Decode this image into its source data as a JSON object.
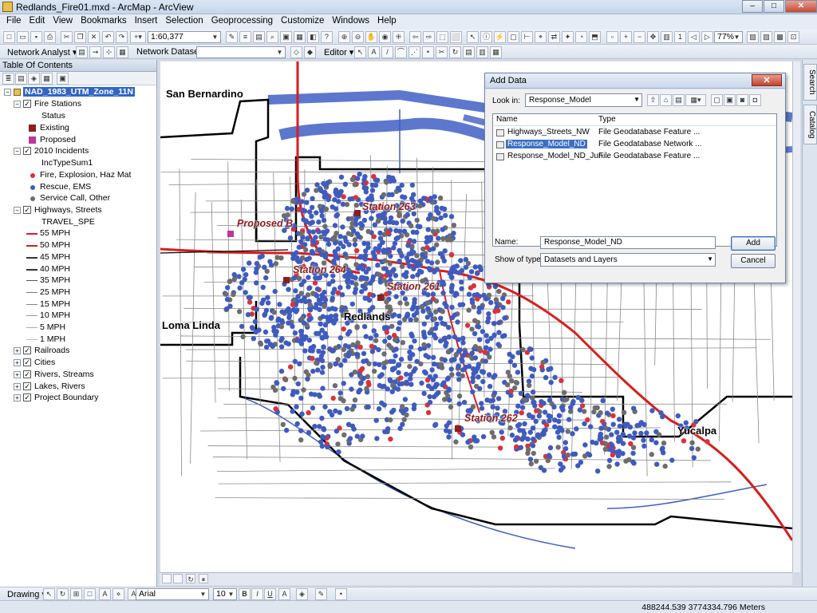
{
  "window": {
    "title": "Redlands_Fire01.mxd - ArcMap - ArcView",
    "minimize": "–",
    "maximize": "□",
    "close": "✕"
  },
  "menu": [
    "File",
    "Edit",
    "View",
    "Bookmarks",
    "Insert",
    "Selection",
    "Geoprocessing",
    "Customize",
    "Windows",
    "Help"
  ],
  "toolbar": {
    "scale": "1:60,377",
    "zoom_percent": "77%",
    "network_analyst": "Network Analyst ▾",
    "network_dataset_label": "Network Dataset:",
    "network_dataset_value": "",
    "editor": "Editor ▾"
  },
  "toc": {
    "title": "Table Of Contents",
    "dataframe": "NAD_1983_UTM_Zone_11N",
    "fire_stations": {
      "name": "Fire Stations",
      "field": "Status",
      "classes": [
        {
          "label": "Existing",
          "color": "#8b1e22"
        },
        {
          "label": "Proposed",
          "color": "#c0359a"
        }
      ]
    },
    "incidents": {
      "name": "2010 Incidents",
      "field": "IncTypeSum1",
      "classes": [
        {
          "label": "Fire, Explosion, Haz Mat",
          "color": "#d9323a"
        },
        {
          "label": "Rescue, EMS",
          "color": "#3f5bbf"
        },
        {
          "label": "Service Call, Other",
          "color": "#6d6d6d"
        }
      ]
    },
    "highways": {
      "name": "Highways, Streets",
      "field": "TRAVEL_SPE",
      "classes": [
        {
          "label": "55 MPH",
          "color": "#d81e1e"
        },
        {
          "label": "50 MPH",
          "color": "#d81e1e"
        },
        {
          "label": "45 MPH",
          "color": "#333333"
        },
        {
          "label": "40 MPH",
          "color": "#333333"
        },
        {
          "label": "35 MPH",
          "color": "#555555"
        },
        {
          "label": "25 MPH",
          "color": "#777777"
        },
        {
          "label": "15 MPH",
          "color": "#888888"
        },
        {
          "label": "10 MPH",
          "color": "#999999"
        },
        {
          "label": "5 MPH",
          "color": "#aaaaaa"
        },
        {
          "label": "1 MPH",
          "color": "#bbbbbb"
        }
      ]
    },
    "other_layers": [
      "Railroads",
      "Cities",
      "Rivers, Streams",
      "Lakes, Rivers",
      "Project Boundary"
    ]
  },
  "map": {
    "cities": [
      "San Bernardino",
      "Loma Linda",
      "Redlands",
      "Yucalpa"
    ],
    "stations": [
      "Station 263",
      "Station 264",
      "Station 261",
      "Station 262",
      "Proposed B"
    ]
  },
  "dialog": {
    "title": "Add Data",
    "look_in_label": "Look in:",
    "look_in_value": "Response_Model",
    "col_name": "Name",
    "col_type": "Type",
    "rows": [
      {
        "name": "Highways_Streets_NW",
        "type": "File Geodatabase Feature ..."
      },
      {
        "name": "Response_Model_ND",
        "type": "File Geodatabase Network ..."
      },
      {
        "name": "Response_Model_ND_Jun...",
        "type": "File Geodatabase Feature ..."
      }
    ],
    "name_label": "Name:",
    "name_value": "Response_Model_ND",
    "type_label": "Show of type:",
    "type_value": "Datasets and Layers",
    "add": "Add",
    "cancel": "Cancel"
  },
  "sidetabs": [
    "Search",
    "Catalog"
  ],
  "drawing": {
    "label": "Drawing ▾",
    "font": "Arial",
    "size": "10"
  },
  "status": {
    "coordinates": "488244.539  3774334.796 Meters"
  }
}
